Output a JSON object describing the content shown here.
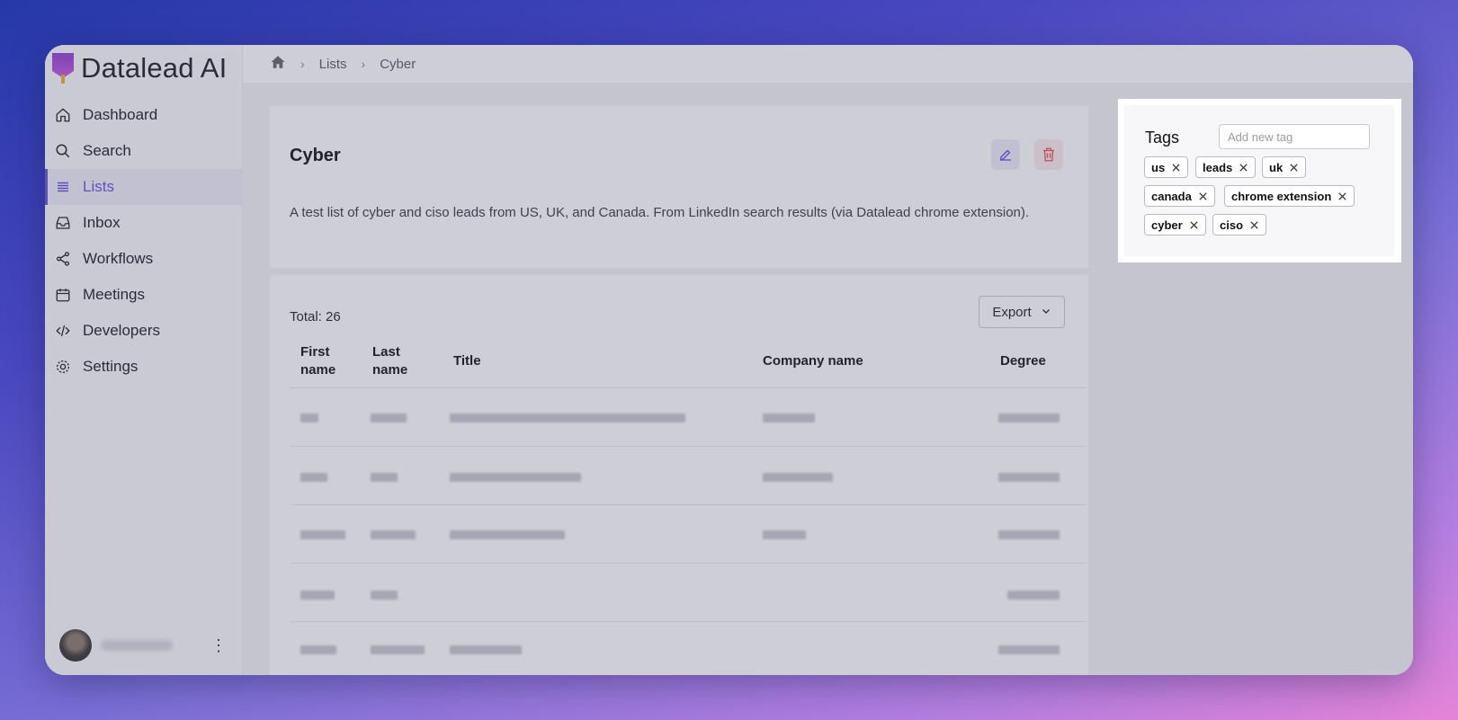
{
  "app": {
    "name": "Datalead AI"
  },
  "sidebar": {
    "items": [
      {
        "label": "Dashboard",
        "icon": "home-icon"
      },
      {
        "label": "Search",
        "icon": "search-icon"
      },
      {
        "label": "Lists",
        "icon": "list-icon",
        "active": true
      },
      {
        "label": "Inbox",
        "icon": "inbox-icon"
      },
      {
        "label": "Workflows",
        "icon": "share-icon"
      },
      {
        "label": "Meetings",
        "icon": "calendar-icon"
      },
      {
        "label": "Developers",
        "icon": "code-icon"
      },
      {
        "label": "Settings",
        "icon": "gear-icon"
      }
    ],
    "user_menu": {
      "kebab": "⋮"
    }
  },
  "breadcrumb": {
    "home_icon": "home-icon",
    "items": [
      "Lists",
      "Cyber"
    ],
    "separator": "›"
  },
  "list": {
    "title": "Cyber",
    "description": "A test list of cyber and ciso leads from US, UK, and Canada. From LinkedIn search results (via Datalead chrome extension).",
    "edit_icon": "pencil-icon",
    "delete_icon": "trash-icon"
  },
  "table": {
    "total_label": "Total: 26",
    "export_label": "Export",
    "columns": [
      "First name",
      "Last name",
      "Title",
      "Company name",
      "Degree"
    ]
  },
  "tags": {
    "label": "Tags",
    "input_placeholder": "Add new tag",
    "items": [
      "us",
      "leads",
      "uk",
      "canada",
      "chrome extension",
      "cyber",
      "ciso"
    ]
  },
  "colors": {
    "accent": "#6b4fd8",
    "danger": "#e05555"
  }
}
